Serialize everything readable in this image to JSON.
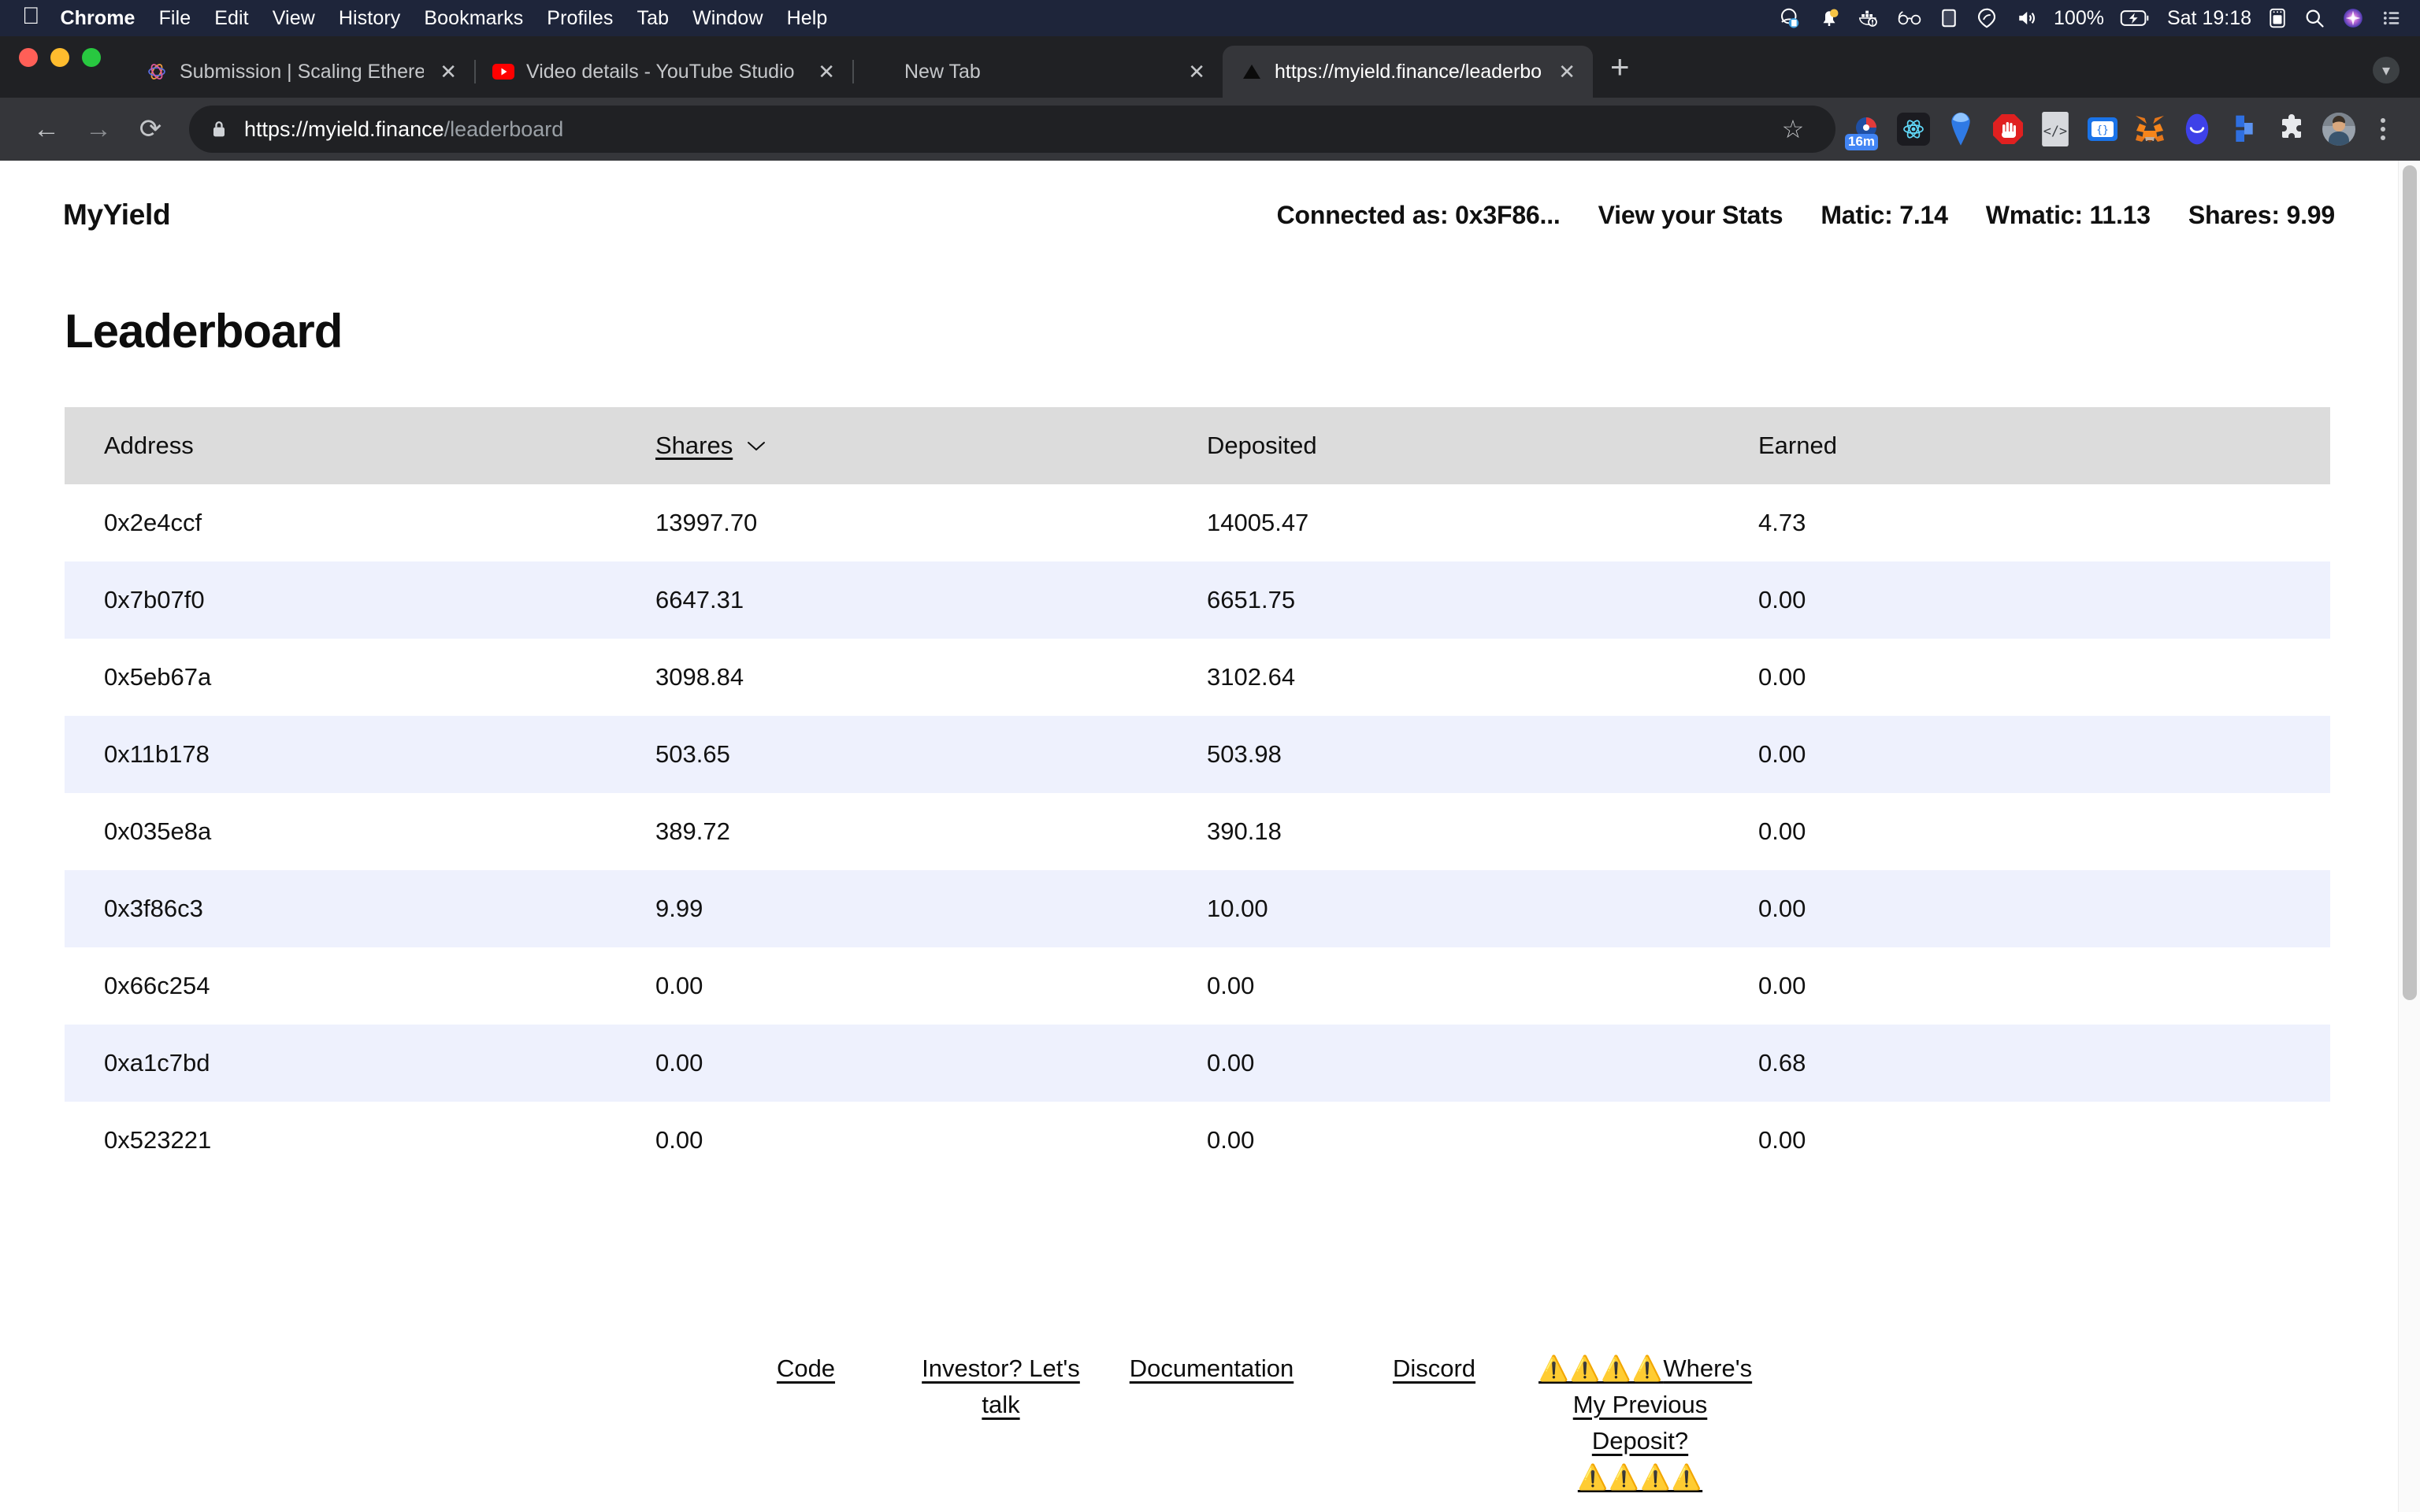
{
  "os_menubar": {
    "apple_icon": "apple-logo",
    "items": [
      "Chrome",
      "File",
      "Edit",
      "View",
      "History",
      "Bookmarks",
      "Profiles",
      "Tab",
      "Window",
      "Help"
    ],
    "status_icons": [
      "screen-recording-icon",
      "notification-bell-icon",
      "docker-icon",
      "glasses-icon",
      "display-icon",
      "screencast-icon",
      "volume-icon"
    ],
    "battery_percent": "100%",
    "battery_icon": "battery-charging-icon",
    "clock": "Sat 19:18",
    "right_icons": [
      "control-center-icon",
      "spotlight-search-icon",
      "siri-icon",
      "list-menu-icon"
    ]
  },
  "browser": {
    "traffic_lights": [
      "close",
      "minimize",
      "maximize"
    ],
    "tabs": [
      {
        "title": "Submission | Scaling Ethereum",
        "favicon": "ethereum-globe-icon",
        "active": false,
        "close_label": "✕"
      },
      {
        "title": "Video details - YouTube Studio",
        "favicon": "youtube-icon",
        "active": false,
        "close_label": "✕"
      },
      {
        "title": "New Tab",
        "favicon": "blank-icon",
        "active": false,
        "close_label": "✕"
      },
      {
        "title": "https://myield.finance/leaderbo",
        "favicon": "vercel-triangle-icon",
        "active": true,
        "close_label": "✕"
      }
    ],
    "new_tab_label": "+",
    "download_badge_icon": "download-arrow-icon",
    "nav": {
      "back_label": "←",
      "forward_label": "→",
      "reload_label": "⟳"
    },
    "omnibox": {
      "lock_icon": "lock-icon",
      "url_domain": "https://myield.finance",
      "url_path": "/leaderboard",
      "star_icon": "bookmark-star-icon"
    },
    "extensions": [
      {
        "name": "time-tracker-extension-icon",
        "badge": "16m"
      },
      {
        "name": "react-devtools-icon",
        "badge": ""
      },
      {
        "name": "pin-marker-extension-icon",
        "badge": ""
      },
      {
        "name": "adblock-stop-hand-icon",
        "badge": ""
      },
      {
        "name": "code-brackets-extension-icon",
        "badge": ""
      },
      {
        "name": "json-viewer-extension-icon",
        "badge": ""
      },
      {
        "name": "metamask-fox-icon",
        "badge": ""
      },
      {
        "name": "blue-oval-wallet-icon",
        "badge": ""
      },
      {
        "name": "blue-block-extension-icon",
        "badge": ""
      },
      {
        "name": "puzzle-piece-extensions-icon",
        "badge": ""
      },
      {
        "name": "profile-avatar",
        "badge": ""
      }
    ],
    "menu_icon": "three-dot-menu-icon"
  },
  "app": {
    "brand": "MyYield",
    "header_nav": [
      "Connected as: 0x3F86...",
      "View your Stats",
      "Matic: 7.14",
      "Wmatic: 11.13",
      "Shares: 9.99"
    ],
    "page_title": "Leaderboard"
  },
  "table": {
    "columns": [
      {
        "label": "Address",
        "sorted": false
      },
      {
        "label": "Shares",
        "sorted": true,
        "sort_icon": "chevron-down-icon"
      },
      {
        "label": "Deposited",
        "sorted": false
      },
      {
        "label": "Earned",
        "sorted": false
      }
    ],
    "rows": [
      {
        "address": "0x2e4ccf",
        "shares": "13997.70",
        "deposited": "14005.47",
        "earned": "4.73"
      },
      {
        "address": "0x7b07f0",
        "shares": "6647.31",
        "deposited": "6651.75",
        "earned": "0.00"
      },
      {
        "address": "0x5eb67a",
        "shares": "3098.84",
        "deposited": "3102.64",
        "earned": "0.00"
      },
      {
        "address": "0x11b178",
        "shares": "503.65",
        "deposited": "503.98",
        "earned": "0.00"
      },
      {
        "address": "0x035e8a",
        "shares": "389.72",
        "deposited": "390.18",
        "earned": "0.00"
      },
      {
        "address": "0x3f86c3",
        "shares": "9.99",
        "deposited": "10.00",
        "earned": "0.00"
      },
      {
        "address": "0x66c254",
        "shares": "0.00",
        "deposited": "0.00",
        "earned": "0.00"
      },
      {
        "address": "0xa1c7bd",
        "shares": "0.00",
        "deposited": "0.00",
        "earned": "0.68"
      },
      {
        "address": "0x523221",
        "shares": "0.00",
        "deposited": "0.00",
        "earned": "0.00"
      }
    ]
  },
  "footer": {
    "links": [
      "Code",
      "Investor? Let's talk",
      "Documentation",
      "Discord"
    ],
    "warning_link": {
      "lead_warnings": "⚠️⚠️⚠️⚠️",
      "text": "Where's My Previous Deposit?",
      "trail_warnings": "⚠️⚠️⚠️⚠️"
    }
  },
  "colors": {
    "menubar_bg": "#1e253a",
    "chrome_bg": "#202124",
    "toolbar_bg": "#35363a",
    "table_header_bg": "#dcdcdc",
    "row_alt_bg": "#eef1fd",
    "warning_yellow": "#f5a623"
  }
}
